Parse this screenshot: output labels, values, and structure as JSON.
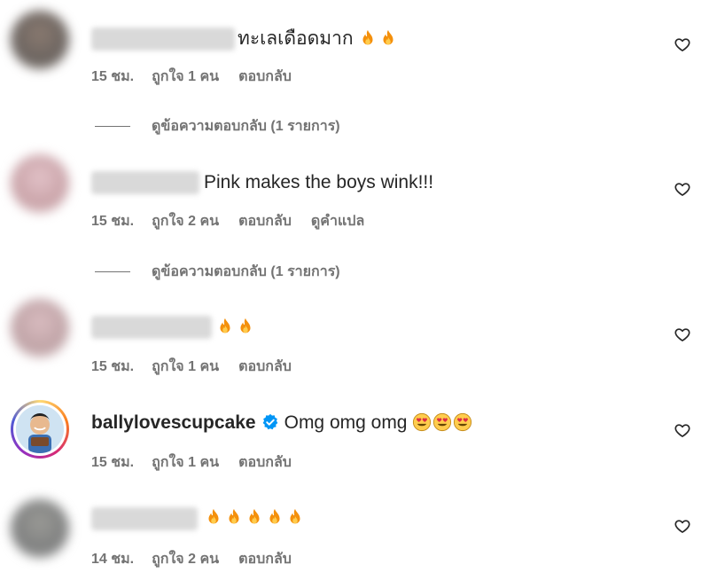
{
  "comments": [
    {
      "username": "",
      "text": "ทะเลเดือดมาก",
      "emojis": [
        "fire",
        "fire"
      ],
      "time": "15 ชม.",
      "likes": "ถูกใจ 1 คน",
      "reply": "ตอบกลับ",
      "translate": "",
      "view_replies": "ดูข้อความตอบกลับ (1 รายการ)"
    },
    {
      "username": "",
      "text": "Pink makes the boys wink!!!",
      "emojis": [],
      "time": "15 ชม.",
      "likes": "ถูกใจ 2 คน",
      "reply": "ตอบกลับ",
      "translate": "ดูคำแปล",
      "view_replies": "ดูข้อความตอบกลับ (1 รายการ)"
    },
    {
      "username": "",
      "text": "",
      "emojis": [
        "fire",
        "fire"
      ],
      "time": "15 ชม.",
      "likes": "ถูกใจ 1 คน",
      "reply": "ตอบกลับ",
      "translate": "",
      "view_replies": ""
    },
    {
      "username": "ballylovescupcake",
      "verified": true,
      "text": "Omg omg omg",
      "emojis": [
        "heart-eyes",
        "heart-eyes",
        "heart-eyes"
      ],
      "time": "15 ชม.",
      "likes": "ถูกใจ 1 คน",
      "reply": "ตอบกลับ",
      "translate": "",
      "view_replies": ""
    },
    {
      "username": "",
      "text": "",
      "emojis": [
        "fire",
        "fire",
        "fire",
        "fire",
        "fire"
      ],
      "time": "14 ชม.",
      "likes": "ถูกใจ 2 คน",
      "reply": "ตอบกลับ",
      "translate": "",
      "view_replies": ""
    }
  ],
  "colors": {
    "text": "#262626",
    "meta": "#737373",
    "verified": "#0095f6",
    "story_ring": "#d62976"
  },
  "icons": {
    "like": "heart-outline-icon",
    "verified": "verified-badge-icon",
    "fire": "fire-emoji-icon",
    "heart_eyes": "heart-eyes-emoji-icon"
  }
}
